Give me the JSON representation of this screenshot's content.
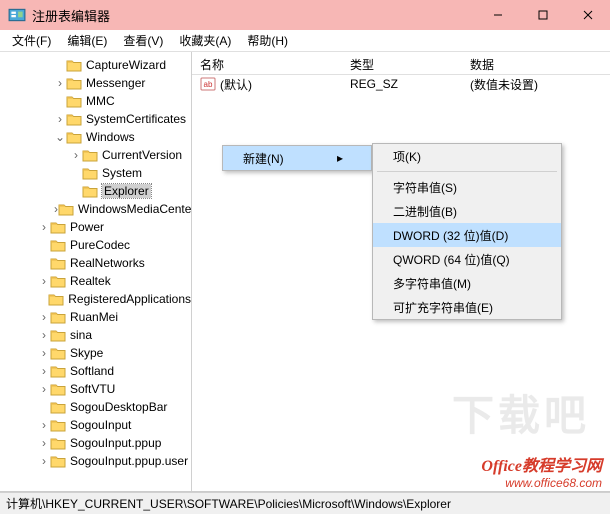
{
  "titlebar": {
    "title": "注册表编辑器"
  },
  "menubar": {
    "file": "文件(F)",
    "edit": "编辑(E)",
    "view": "查看(V)",
    "fav": "收藏夹(A)",
    "help": "帮助(H)"
  },
  "tree": {
    "items": [
      {
        "level": 3,
        "toggle": "",
        "label": "CaptureWizard"
      },
      {
        "level": 3,
        "toggle": ">",
        "label": "Messenger"
      },
      {
        "level": 3,
        "toggle": "",
        "label": "MMC"
      },
      {
        "level": 3,
        "toggle": ">",
        "label": "SystemCertificates"
      },
      {
        "level": 3,
        "toggle": "v",
        "label": "Windows"
      },
      {
        "level": 4,
        "toggle": ">",
        "label": "CurrentVersion"
      },
      {
        "level": 4,
        "toggle": "",
        "label": "System"
      },
      {
        "level": 4,
        "toggle": "",
        "label": "Explorer",
        "selected": true
      },
      {
        "level": 3,
        "toggle": ">",
        "label": "WindowsMediaCenter"
      },
      {
        "level": 2,
        "toggle": ">",
        "label": "Power"
      },
      {
        "level": 2,
        "toggle": "",
        "label": "PureCodec"
      },
      {
        "level": 2,
        "toggle": "",
        "label": "RealNetworks"
      },
      {
        "level": 2,
        "toggle": ">",
        "label": "Realtek"
      },
      {
        "level": 2,
        "toggle": "",
        "label": "RegisteredApplications"
      },
      {
        "level": 2,
        "toggle": ">",
        "label": "RuanMei"
      },
      {
        "level": 2,
        "toggle": ">",
        "label": "sina"
      },
      {
        "level": 2,
        "toggle": ">",
        "label": "Skype"
      },
      {
        "level": 2,
        "toggle": ">",
        "label": "Softland"
      },
      {
        "level": 2,
        "toggle": ">",
        "label": "SoftVTU"
      },
      {
        "level": 2,
        "toggle": "",
        "label": "SogouDesktopBar"
      },
      {
        "level": 2,
        "toggle": ">",
        "label": "SogouInput"
      },
      {
        "level": 2,
        "toggle": ">",
        "label": "SogouInput.ppup"
      },
      {
        "level": 2,
        "toggle": ">",
        "label": "SogouInput.ppup.user"
      }
    ]
  },
  "columns": {
    "name": "名称",
    "type": "类型",
    "data": "数据"
  },
  "values": [
    {
      "name": "(默认)",
      "type": "REG_SZ",
      "data": "(数值未设置)"
    }
  ],
  "context1": {
    "new": "新建(N)"
  },
  "context2": {
    "key": "项(K)",
    "string": "字符串值(S)",
    "binary": "二进制值(B)",
    "dword": "DWORD (32 位)值(D)",
    "qword": "QWORD (64 位)值(Q)",
    "multi": "多字符串值(M)",
    "expand": "可扩充字符串值(E)"
  },
  "statusbar": "计算机\\HKEY_CURRENT_USER\\SOFTWARE\\Policies\\Microsoft\\Windows\\Explorer",
  "watermark": {
    "line1": "Office教程学习网",
    "line2": "www.office68.com"
  },
  "bgwatermark": "下载吧"
}
